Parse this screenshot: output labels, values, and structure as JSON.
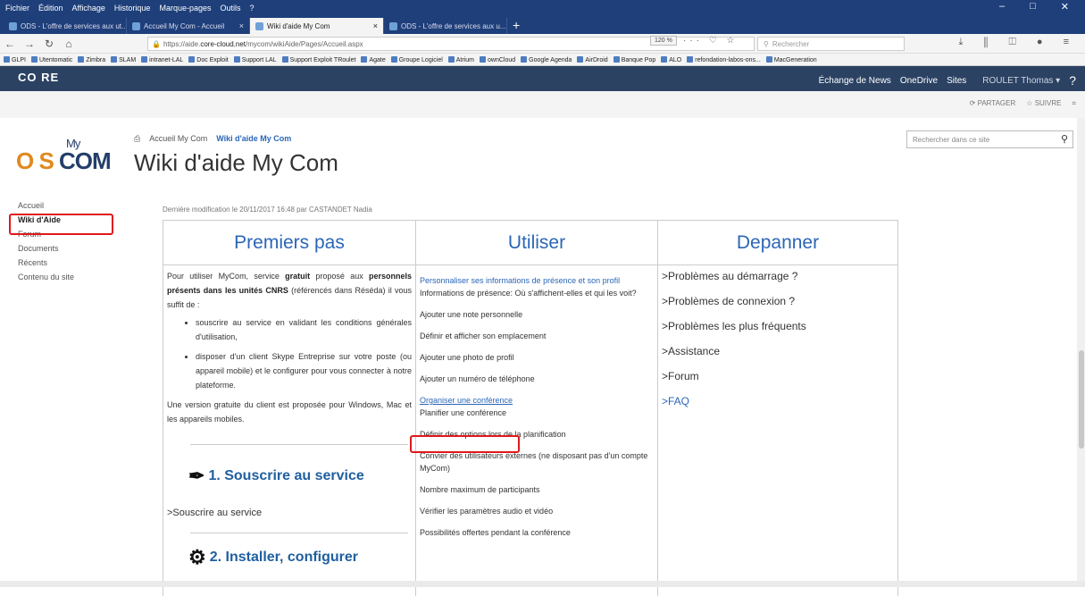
{
  "menu": [
    "Fichier",
    "Édition",
    "Affichage",
    "Historique",
    "Marque-pages",
    "Outils",
    "?"
  ],
  "window_controls": [
    "–",
    "□",
    "✕"
  ],
  "tabs": [
    {
      "label": "ODS - L'offre de services aux ut...",
      "active": false
    },
    {
      "label": "Accueil My Com - Accueil",
      "active": false
    },
    {
      "label": "Wiki d'aide My Com",
      "active": true
    },
    {
      "label": "ODS - L'offre de services aux u...",
      "active": false
    }
  ],
  "url": {
    "prefix": "https://aide.",
    "domain": "core-cloud.net",
    "path": "/mycom/wikiAide/Pages/Accueil.aspx"
  },
  "zoom": "120 %",
  "search_placeholder": "Rechercher",
  "bookmarks": [
    "GLPI",
    "Utentomatic",
    "Zimbra",
    "SLAM",
    "intranet-LAL",
    "Doc Exploit",
    "Support LAL",
    "Support Exploit TRoulet",
    "Agate",
    "Groupe Logiciel",
    "Atrium",
    "ownCloud",
    "Google Agenda",
    "AirDroid",
    "Banque Pop",
    "ALO",
    "refondation-labos-ons...",
    "MacGeneration"
  ],
  "suite": {
    "logo": "CO RE",
    "links": [
      "Échange de News",
      "OneDrive",
      "Sites"
    ],
    "user": "ROULET Thomas ▾",
    "help": "?"
  },
  "share": {
    "partager": "PARTAGER",
    "suivre": "SUIVRE"
  },
  "site_logo": {
    "my": "My",
    "os": "O S",
    "com": "COM"
  },
  "breadcrumb": {
    "home": "Accueil My Com",
    "current": "Wiki d'aide My Com"
  },
  "page_title": "Wiki d'aide My Com",
  "site_search_placeholder": "Rechercher dans ce site",
  "leftnav": [
    "Accueil",
    "Wiki d'Aide",
    "Forum",
    "Documents",
    "Récents",
    "Contenu du site"
  ],
  "last_modified": "Dernière modification le 20/11/2017 16:48 par  CASTANDET Nadia",
  "columns": {
    "col1": {
      "title": "Premiers pas",
      "intro_a": "Pour utiliser MyCom, service ",
      "intro_b": "gratuit",
      "intro_c": " proposé aux ",
      "intro_d": "personnels présents dans les unités CNRS",
      "intro_e": " (référencés dans Réséda) il vous suffit de :",
      "bullet1": "souscrire au service en validant les conditions générales d'utilisation,",
      "bullet2": "disposer d'un client Skype Entreprise sur votre poste (ou appareil mobile) et le configurer pour vous connecter à notre plateforme.",
      "version": "Une version gratuite du client est proposée pour Windows, Mac et les appareils mobiles.",
      "section1": "1. Souscrire au service",
      "link1": ">Souscrire au service",
      "section2": "2. Installer, configurer"
    },
    "col2": {
      "title": "Utiliser",
      "items": [
        "Personnaliser ses informations de présence et son profil",
        "Informations de présence: Où s'affichent-elles et qui les voit?",
        "Ajouter une note personnelle",
        "Définir et afficher son emplacement",
        "Ajouter une photo de profil",
        "Ajouter un numéro de téléphone",
        "Organiser une conférence",
        "Planifier une conférence",
        "Définir des options lors de la planification",
        "Convier des utilisateurs externes (ne disposant pas d'un compte MyCom)",
        "Nombre maximum de participants",
        "Vérifier les paramètres audio et vidéo",
        "Possibilités offertes pendant la conférence"
      ]
    },
    "col3": {
      "title": "Depanner",
      "items": [
        ">Problèmes au démarrage ?",
        ">Problèmes de connexion ?",
        ">Problèmes les plus fréquents",
        ">Assistance",
        ">Forum",
        ">FAQ"
      ]
    }
  },
  "colors": {
    "accent": "#2b66b6",
    "suite": "#2b4263",
    "titlebar": "#1e3f7a",
    "highlight": "#e0181b"
  }
}
